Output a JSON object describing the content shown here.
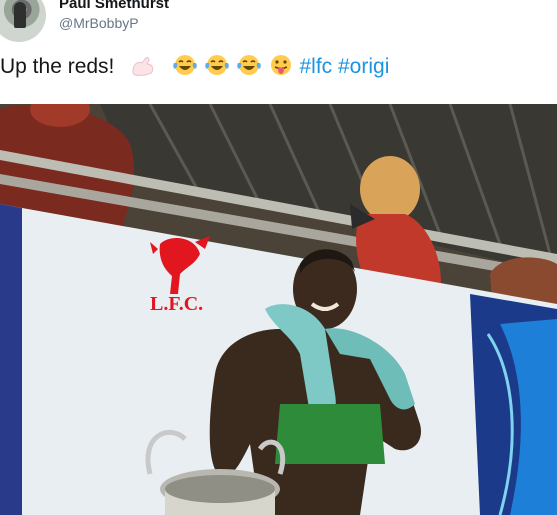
{
  "tweet": {
    "display_name": "Paul Smethurst",
    "handle": "@MrBobbyP",
    "text": "Up the reds!",
    "hashtags": [
      "#lfc",
      "#origi"
    ],
    "emojis": [
      "flexed-biceps",
      "face-with-tears-of-joy",
      "face-with-tears-of-joy",
      "face-with-tears-of-joy",
      "face-with-tongue"
    ]
  },
  "photo": {
    "banner_text": "L.F.C."
  },
  "colors": {
    "text": "#14171a",
    "secondary": "#657786",
    "hashtag": "#1b95e0",
    "lfc_red": "#e2161f"
  }
}
